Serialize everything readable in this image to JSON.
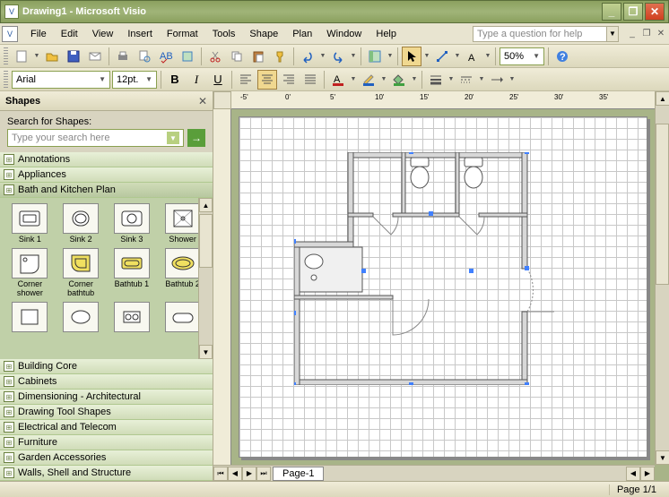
{
  "window": {
    "title": "Drawing1 - Microsoft Visio"
  },
  "menu": {
    "file": "File",
    "edit": "Edit",
    "view": "View",
    "insert": "Insert",
    "format": "Format",
    "tools": "Tools",
    "shape": "Shape",
    "plan": "Plan",
    "window": "Window",
    "help": "Help"
  },
  "helpbox": {
    "placeholder": "Type a question for help"
  },
  "format_toolbar": {
    "font": "Arial",
    "size": "12pt.",
    "zoom": "50%"
  },
  "shapes": {
    "title": "Shapes",
    "search_label": "Search for Shapes:",
    "search_placeholder": "Type your search here",
    "stencils": {
      "s0": "Annotations",
      "s1": "Appliances",
      "s2": "Bath and Kitchen Plan",
      "s3": "Building Core",
      "s4": "Cabinets",
      "s5": "Dimensioning - Architectural",
      "s6": "Drawing Tool Shapes",
      "s7": "Electrical and Telecom",
      "s8": "Furniture",
      "s9": "Garden Accessories",
      "s10": "Walls, Shell and Structure"
    },
    "open_stencil_shapes": {
      "i0": "Sink 1",
      "i1": "Sink 2",
      "i2": "Sink 3",
      "i3": "Shower",
      "i4": "Corner shower",
      "i5": "Corner bathtub",
      "i6": "Bathtub 1",
      "i7": "Bathtub 2"
    }
  },
  "ruler": {
    "t0": "-5'",
    "t1": "0'",
    "t2": "5'",
    "t3": "10'",
    "t4": "15'",
    "t5": "20'",
    "t6": "25'",
    "t7": "30'",
    "t8": "35'"
  },
  "page_tabs": {
    "p1": "Page-1"
  },
  "status": {
    "page": "Page 1/1"
  }
}
